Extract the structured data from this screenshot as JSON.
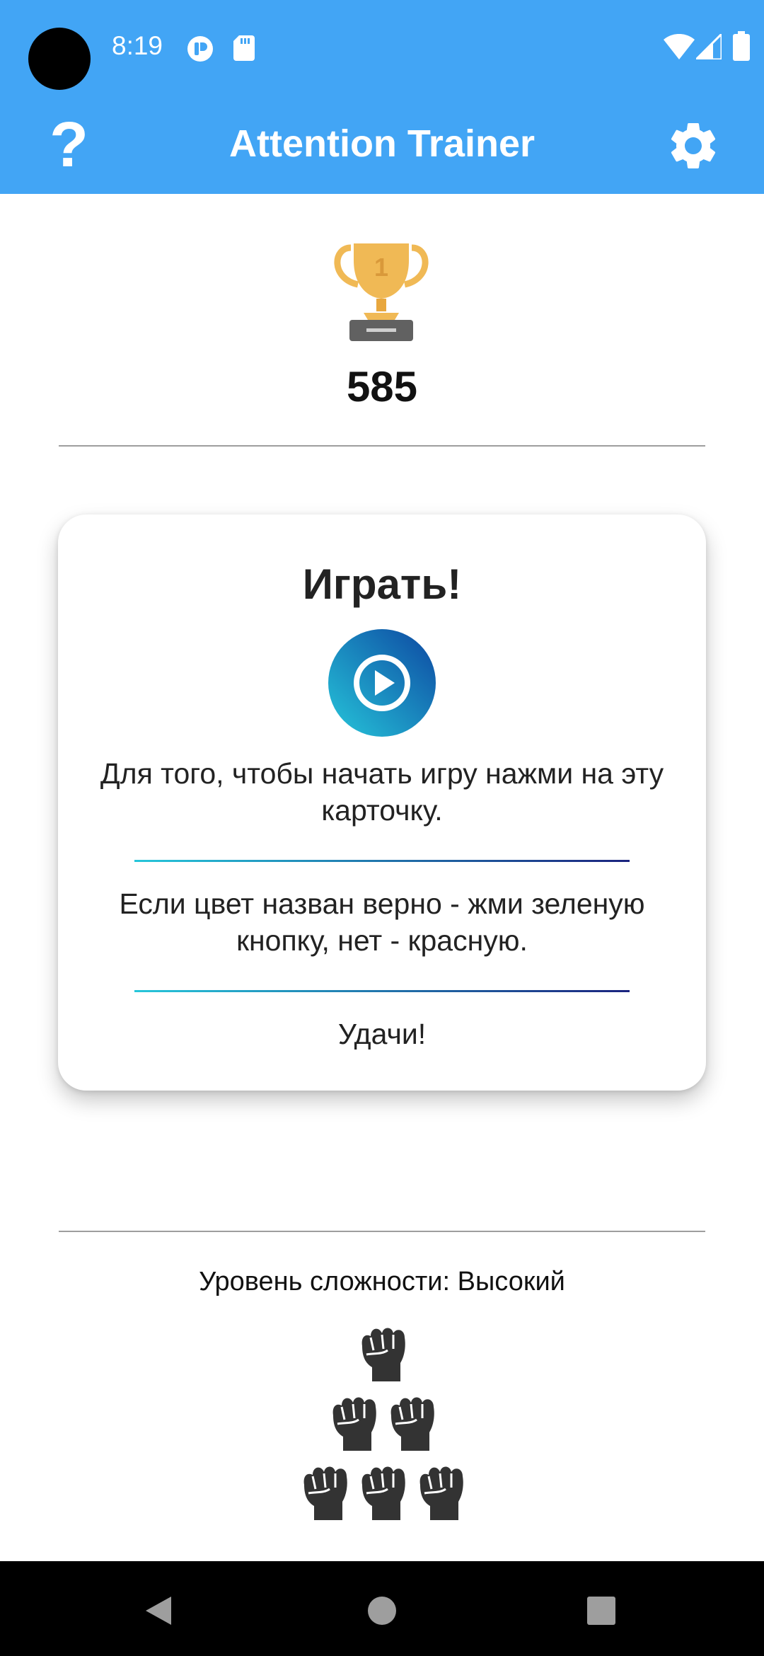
{
  "status_bar": {
    "time": "8:19"
  },
  "app_bar": {
    "title": "Attention Trainer",
    "help_label": "?"
  },
  "score": {
    "value": "585"
  },
  "play_card": {
    "title": "Играть!",
    "instruction": "Для того, чтобы начать игру нажми на эту карточку.",
    "rules": "Если цвет назван верно - жми зеленую кнопку, нет - красную.",
    "good_luck": "Удачи!"
  },
  "difficulty": {
    "label": "Уровень сложности: Высокий",
    "level": 6
  },
  "colors": {
    "app_bar": "#42a5f5",
    "trophy": "#f0b955",
    "play_gradient_start": "#26c6da",
    "play_gradient_end": "#0d47a1",
    "fist": "#333333"
  },
  "icons": [
    "help-icon",
    "gear-icon",
    "trophy-icon",
    "play-icon",
    "fist-icon",
    "back-icon",
    "home-icon",
    "recents-icon"
  ]
}
